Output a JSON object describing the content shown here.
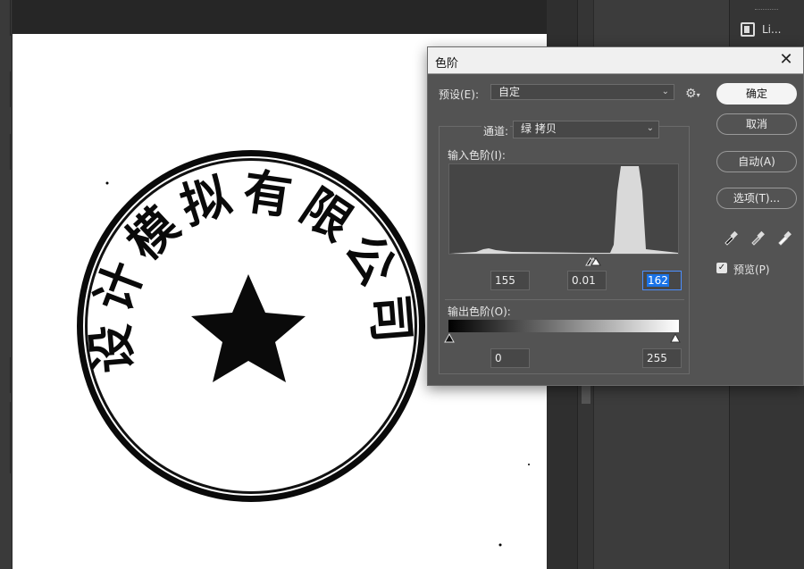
{
  "dialog": {
    "title": "色阶",
    "preset_label": "预设(E):",
    "preset_value": "自定",
    "channel_label": "通道:",
    "channel_value": "绿 拷贝",
    "input_levels_label": "输入色阶(I):",
    "input_black": "155",
    "input_gamma": "0.01",
    "input_white": "162",
    "output_levels_label": "输出色阶(O):",
    "output_black": "0",
    "output_white": "255",
    "preview_label": "预览(P)",
    "preview_checked": true
  },
  "buttons": {
    "ok": "确定",
    "cancel": "取消",
    "auto": "自动(A)",
    "options": "选项(T)..."
  },
  "panel": {
    "libraries_label": "Li..."
  },
  "seal": {
    "text": "设计模拟有限公司",
    "center_icon": "star"
  },
  "colors": {
    "dialog_bg": "#535353",
    "histogram_fill": "#d9d9d9",
    "selection": "#1a73e8"
  }
}
